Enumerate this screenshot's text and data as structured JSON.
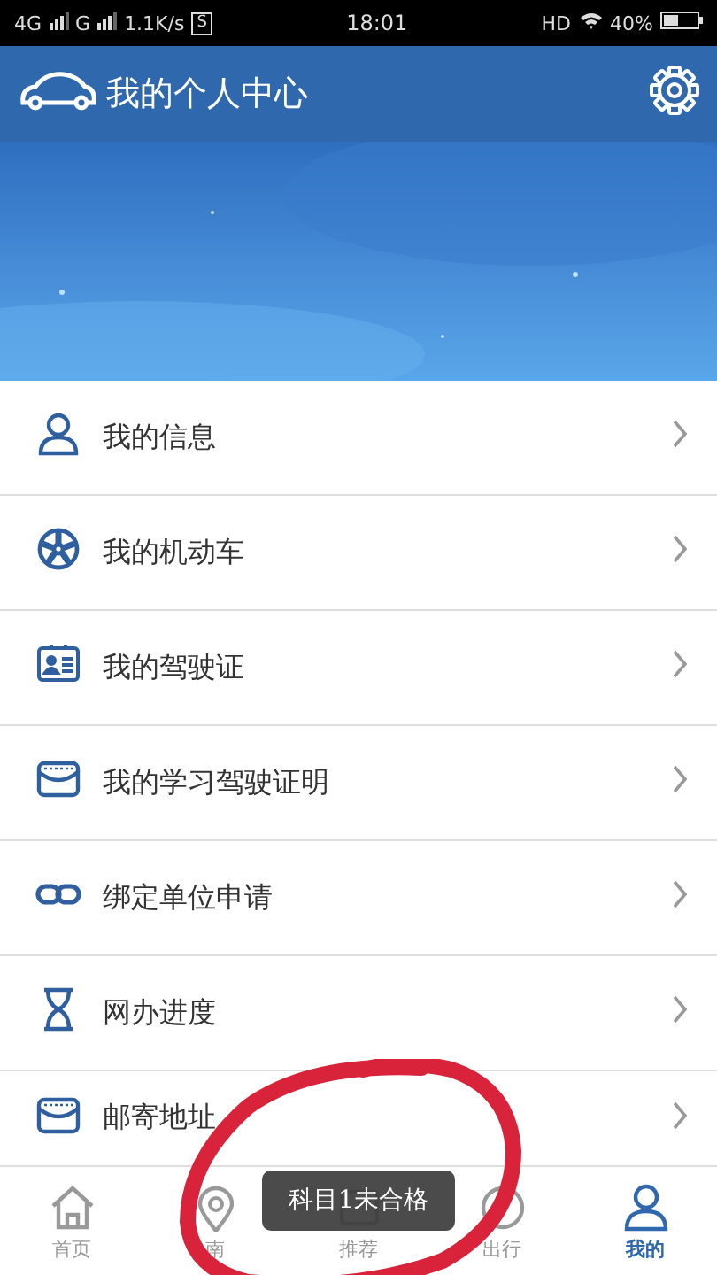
{
  "status_bar": {
    "network_1": "4G",
    "network_2": "G",
    "speed": "1.1K/s",
    "badge": "S",
    "time": "18:01",
    "hd": "HD",
    "battery": "40%"
  },
  "header": {
    "title": "我的个人中心"
  },
  "menu": [
    {
      "label": "我的信息"
    },
    {
      "label": "我的机动车"
    },
    {
      "label": "我的驾驶证"
    },
    {
      "label": "我的学习驾驶证明"
    },
    {
      "label": "绑定单位申请"
    },
    {
      "label": "网办进度"
    },
    {
      "label": "邮寄地址"
    }
  ],
  "nav": [
    {
      "label": "首页",
      "selected": false
    },
    {
      "label": "南",
      "selected": false
    },
    {
      "label": "推荐",
      "selected": false
    },
    {
      "label": "出行",
      "selected": false
    },
    {
      "label": "我的",
      "selected": true
    }
  ],
  "toast": "科目1未合格"
}
